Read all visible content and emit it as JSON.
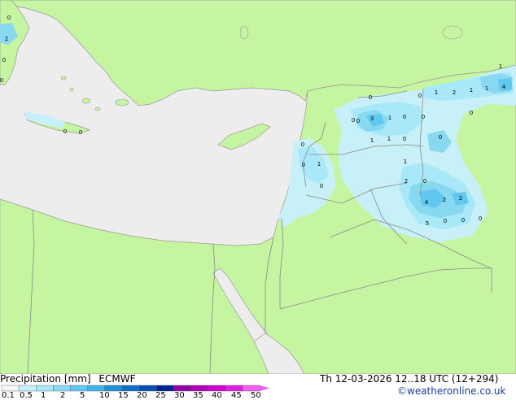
{
  "map": {
    "point_values": [
      "2",
      "0",
      "0",
      "0",
      "0",
      "0",
      "0",
      "0",
      "0",
      "3",
      "1",
      "0",
      "1",
      "1",
      "0",
      "1",
      "2",
      "1",
      "1",
      "4",
      "1",
      "0",
      "0",
      "0",
      "1",
      "0",
      "0",
      "1",
      "0",
      "0",
      "2",
      "0",
      "4",
      "2",
      "2",
      "5",
      "0",
      "0",
      "0"
    ]
  },
  "legend": {
    "title": "Precipitation [mm]",
    "model": "ECMWF",
    "ticks": [
      "0.1",
      "0.5",
      "1",
      "2",
      "5",
      "10",
      "15",
      "20",
      "25",
      "30",
      "35",
      "40",
      "45",
      "50"
    ],
    "colors": [
      "#f5f5f5",
      "#c8f0f8",
      "#a8e8f8",
      "#88d8f0",
      "#60c8f0",
      "#40b0e8",
      "#2090d8",
      "#1070c8",
      "#0050b0",
      "#002090",
      "#9000a0",
      "#b000b8",
      "#d000d0",
      "#e020e0",
      "#f060f0"
    ]
  },
  "valid_time": "Th 12-03-2026 12..18 UTC (12+294)",
  "credit": "©weatheronline.co.uk"
}
